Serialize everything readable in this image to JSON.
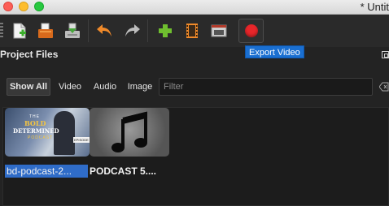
{
  "window": {
    "title": "* Untit"
  },
  "toolbar": {
    "buttons": [
      {
        "name": "new-project-icon"
      },
      {
        "name": "open-project-icon"
      },
      {
        "name": "save-project-icon"
      },
      {
        "name": "undo-icon"
      },
      {
        "name": "redo-icon"
      },
      {
        "name": "import-files-icon"
      },
      {
        "name": "profile-icon"
      },
      {
        "name": "fullscreen-icon"
      },
      {
        "name": "export-video-icon"
      }
    ],
    "record_color": "#e8262a"
  },
  "tooltip": {
    "text": "Export Video"
  },
  "project_files": {
    "title": "Project Files",
    "filters": {
      "show_all": "Show All",
      "video": "Video",
      "audio": "Audio",
      "image": "Image"
    },
    "filter_placeholder": "Filter",
    "items": [
      {
        "label": "bd-podcast-2...",
        "selected": true,
        "thumb_texts": [
          "THE",
          "BOLD",
          "DETERMINED",
          "PODCAST",
          "EPISODE"
        ]
      },
      {
        "label": "PODCAST 5....",
        "selected": false,
        "icon": "music-note-icon"
      }
    ]
  },
  "colors": {
    "selection": "#2f6cc8",
    "tooltip": "#1a6fd1"
  }
}
